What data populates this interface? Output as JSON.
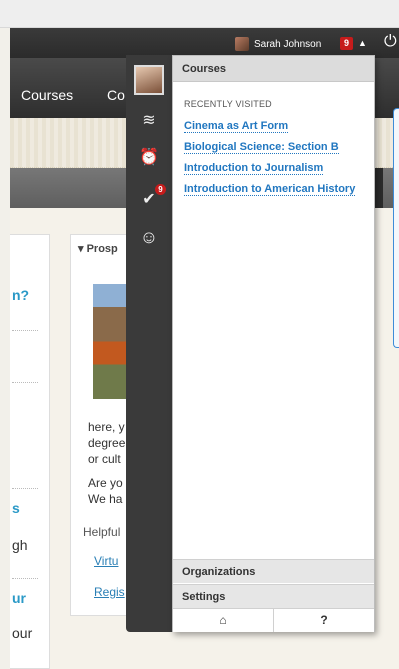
{
  "header": {
    "user_name": "Sarah Johnson",
    "notification_count": "9",
    "caret_glyph": "▲",
    "power_glyph": "⏻"
  },
  "nav": {
    "courses_label": "Courses",
    "partial_label": "Co"
  },
  "background": {
    "left_texts": [
      "n?",
      "s",
      "gh",
      "ur",
      "our"
    ],
    "panel_title": "Prosp",
    "panel_text_1": [
      "here, y",
      "degree",
      "or cult"
    ],
    "panel_text_2": [
      "Are yo",
      "We ha"
    ],
    "helpful": "Helpful",
    "links": [
      "Virtu",
      "Regis"
    ]
  },
  "rail": {
    "icons": [
      "avatar",
      "stream-icon",
      "alarm-clock-icon",
      "grades-icon",
      "smiley-icon"
    ],
    "grades_badge": "9",
    "glyphs": {
      "stream": "≋",
      "alarm": "⏰",
      "grades": "✔",
      "smiley": "☺"
    }
  },
  "flyout": {
    "header": "Courses",
    "recent_label": "RECENTLY VISITED",
    "courses": [
      "Cinema as Art Form",
      "Biological Science: Section B",
      "Introduction to Journalism",
      "Introduction to American History"
    ],
    "organizations_label": "Organizations",
    "settings_label": "Settings",
    "home_glyph": "⌂",
    "help_glyph": "?"
  },
  "colors": {
    "link_blue": "#2177c0",
    "badge_red": "#c61b1b",
    "teal_text": "#2a99c7"
  }
}
